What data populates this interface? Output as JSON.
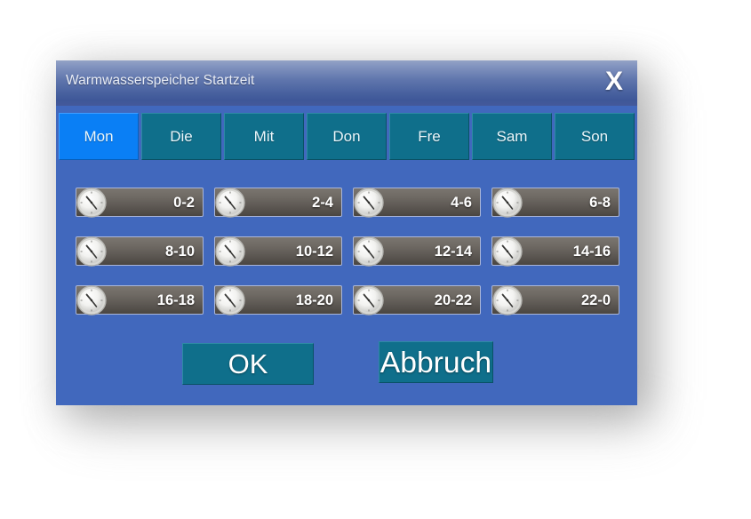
{
  "dialog": {
    "title": "Warmwasserspeicher Startzeit",
    "close_label": "X",
    "close_icon": "close-x-icon"
  },
  "days": {
    "selected": "Mon",
    "items": [
      {
        "label": "Mon",
        "selected": true
      },
      {
        "label": "Die",
        "selected": false
      },
      {
        "label": "Mit",
        "selected": false
      },
      {
        "label": "Don",
        "selected": false
      },
      {
        "label": "Fre",
        "selected": false
      },
      {
        "label": "Sam",
        "selected": false
      },
      {
        "label": "Son",
        "selected": false
      }
    ]
  },
  "timeslots": {
    "icon": "clock-icon",
    "items": [
      {
        "label": "0-2"
      },
      {
        "label": "2-4"
      },
      {
        "label": "4-6"
      },
      {
        "label": "6-8"
      },
      {
        "label": "8-10"
      },
      {
        "label": "10-12"
      },
      {
        "label": "12-14"
      },
      {
        "label": "14-16"
      },
      {
        "label": "16-18"
      },
      {
        "label": "18-20"
      },
      {
        "label": "20-22"
      },
      {
        "label": "22-0"
      }
    ]
  },
  "buttons": {
    "ok": "OK",
    "cancel": "Abbruch"
  },
  "colors": {
    "dialog_body": "#4168bd",
    "tab_inactive": "#0f6f8b",
    "tab_active": "#0a7ff5",
    "slot_fill": "#6f6a64",
    "button_teal": "#0f6f8b",
    "title_bar_top": "#93a2c6",
    "title_bar_bottom": "#3e5798",
    "page_background": "#ffffff"
  }
}
